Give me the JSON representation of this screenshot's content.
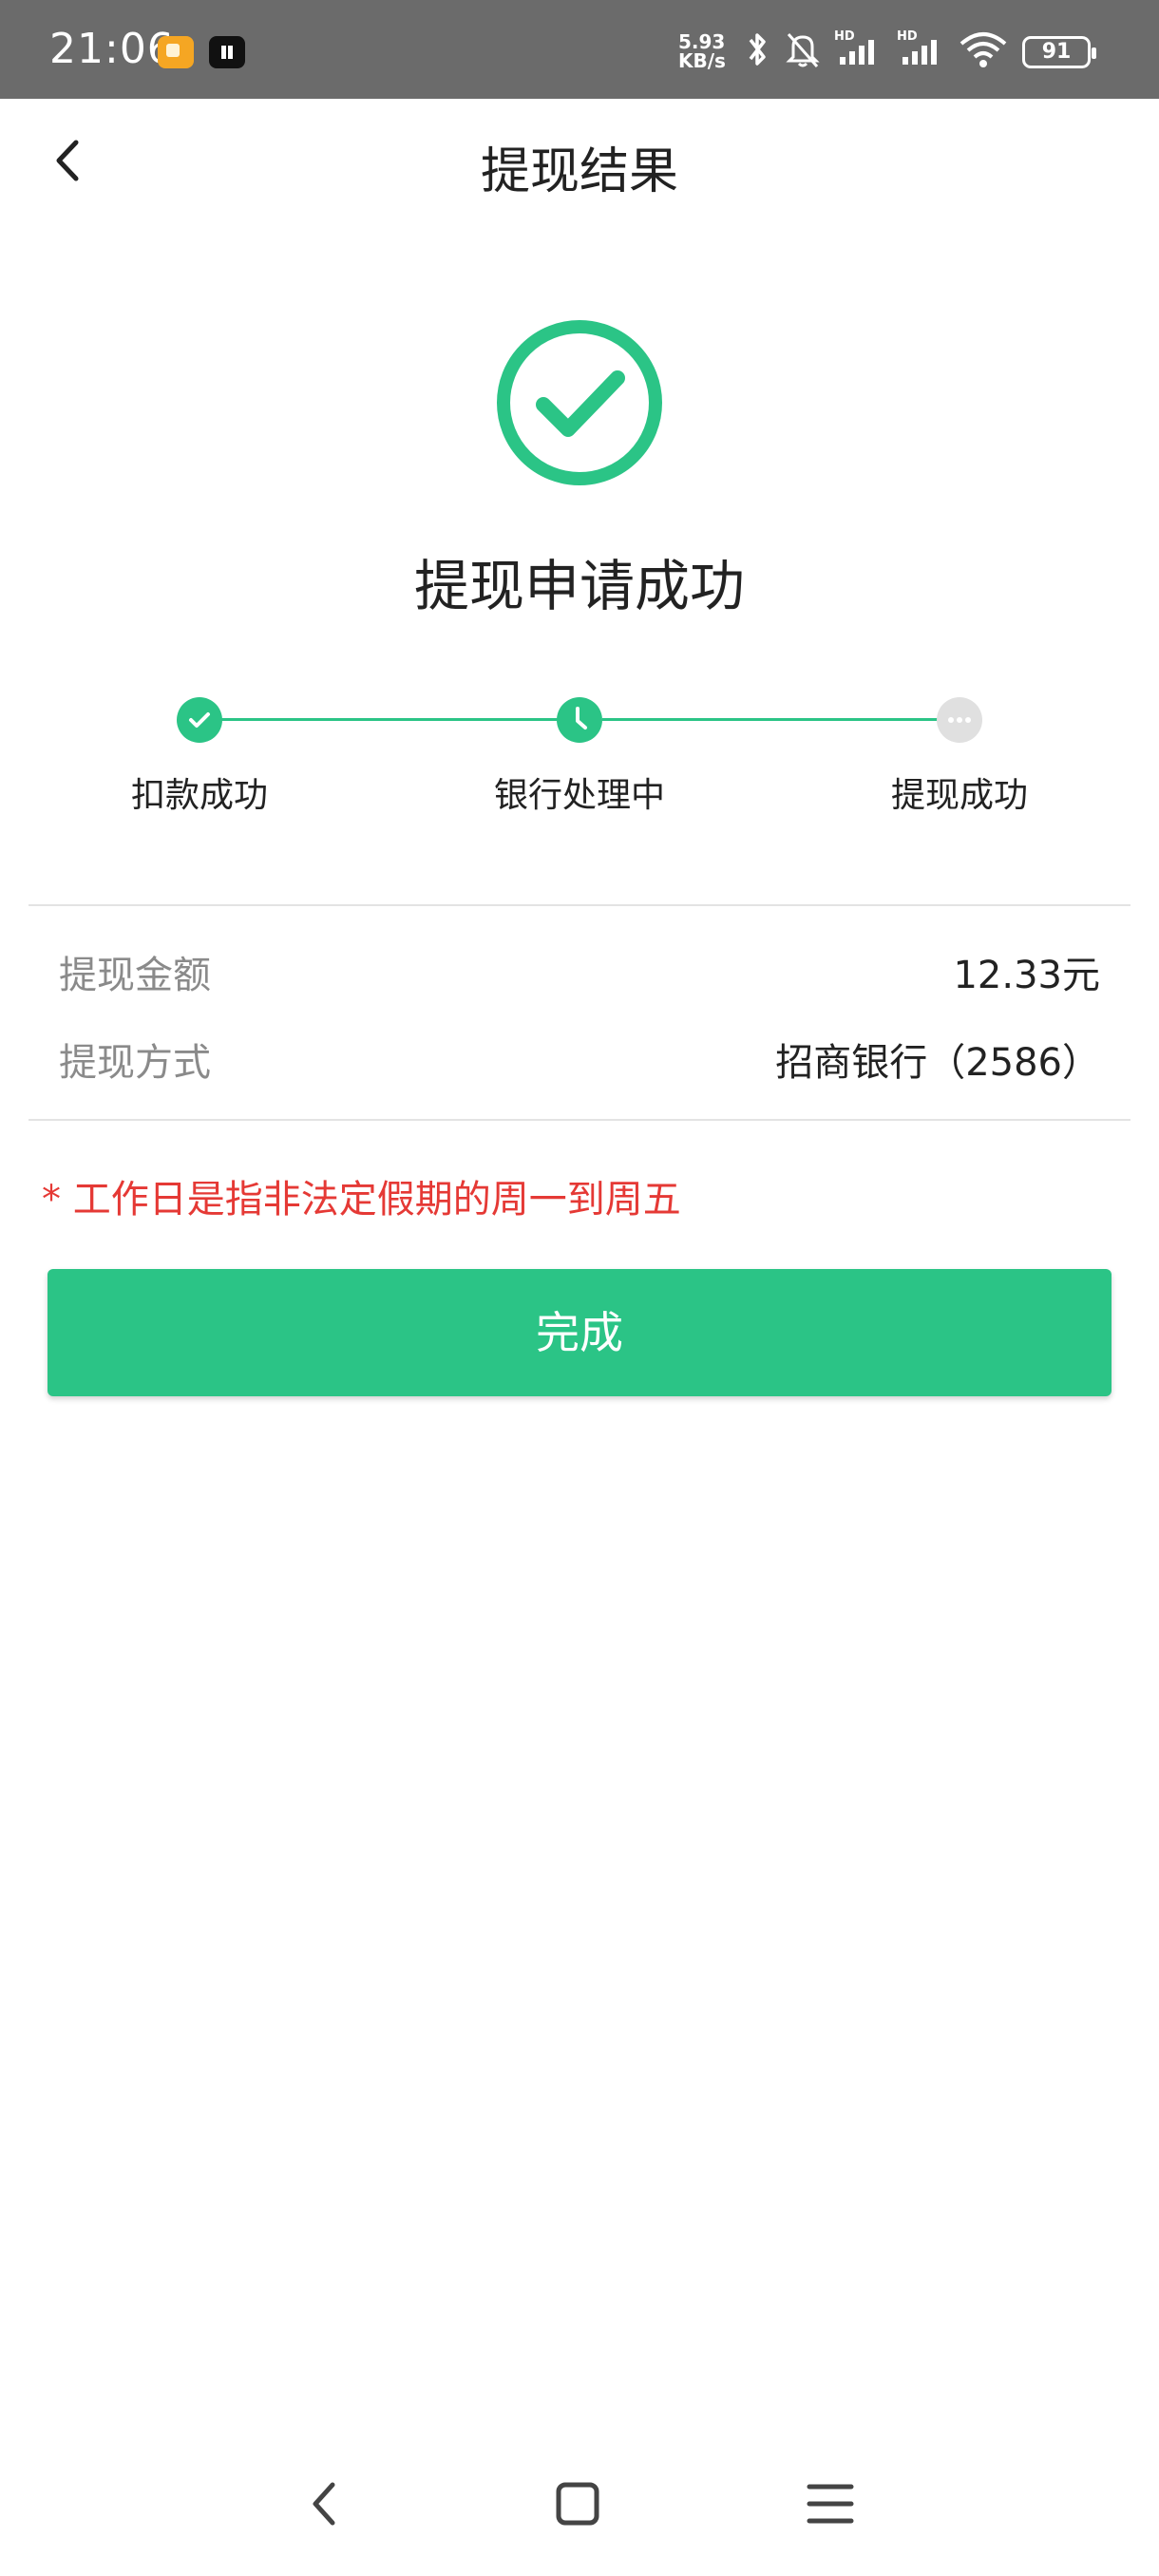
{
  "status_bar": {
    "time": "21:06",
    "net_speed_value": "5.93",
    "net_speed_unit": "KB/s",
    "signal_1_label": "HD",
    "signal_2_label": "HD",
    "battery": "91",
    "icons": [
      "notification-app-icon",
      "media-app-icon",
      "bluetooth-icon",
      "mute-bell-icon",
      "signal-icon",
      "signal-icon",
      "wifi-icon",
      "battery-icon"
    ]
  },
  "header": {
    "title": "提现结果",
    "back_icon": "chevron-left-icon"
  },
  "result": {
    "icon": "check-circle-icon",
    "title": "提现申请成功"
  },
  "steps": [
    {
      "label": "扣款成功",
      "status": "done",
      "icon": "check-icon"
    },
    {
      "label": "银行处理中",
      "status": "current",
      "icon": "clock-icon"
    },
    {
      "label": "提现成功",
      "status": "pending",
      "icon": "more-dots-icon"
    }
  ],
  "details": {
    "amount_label": "提现金额",
    "amount_value": "12.33元",
    "method_label": "提现方式",
    "method_value": "招商银行（2586）"
  },
  "notice": "* 工作日是指非法定假期的周一到周五",
  "done_button": "完成",
  "colors": {
    "accent": "#2bc486",
    "pending": "#e0e0e0",
    "notice": "#e53935",
    "status_bar": "#6b6b6b"
  },
  "nav_bar": [
    "back-nav-icon",
    "home-nav-icon",
    "menu-nav-icon"
  ]
}
